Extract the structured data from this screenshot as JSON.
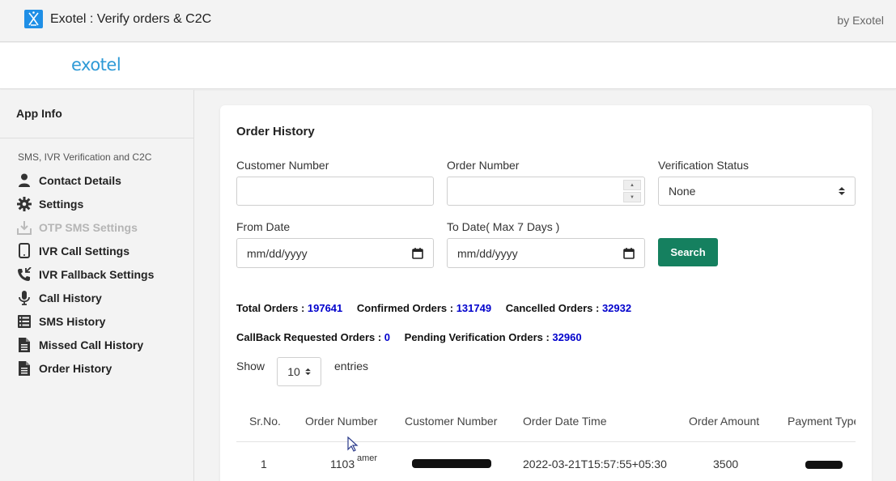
{
  "titlebar": {
    "title": "Exotel : Verify orders & C2C",
    "by": "by Exotel"
  },
  "header": {
    "logo_text": "exotel"
  },
  "sidebar": {
    "app_info": "App Info",
    "section_label": "SMS, IVR Verification and C2C",
    "items": [
      {
        "label": "Contact Details",
        "icon": "user-icon"
      },
      {
        "label": "Settings",
        "icon": "gear-icon"
      },
      {
        "label": "OTP SMS Settings",
        "icon": "download-icon"
      },
      {
        "label": "IVR Call Settings",
        "icon": "mobile-phone-icon"
      },
      {
        "label": "IVR Fallback Settings",
        "icon": "phone-callback-icon"
      },
      {
        "label": "Call History",
        "icon": "microphone-icon"
      },
      {
        "label": "SMS History",
        "icon": "list-icon"
      },
      {
        "label": "Missed Call History",
        "icon": "document-icon"
      },
      {
        "label": "Order History",
        "icon": "document-icon"
      }
    ]
  },
  "main": {
    "title": "Order History",
    "filters": {
      "customer_number_label": "Customer Number",
      "customer_number_value": "",
      "order_number_label": "Order Number",
      "order_number_value": "",
      "verification_status_label": "Verification Status",
      "verification_status_value": "None",
      "from_date_label": "From Date",
      "from_date_placeholder": "mm/dd/yyyy",
      "to_date_label": "To Date( Max 7 Days )",
      "to_date_placeholder": "mm/dd/yyyy",
      "search_label": "Search"
    },
    "stats": {
      "total_label": "Total Orders : ",
      "total_value": "197641",
      "confirmed_label": "Confirmed Orders : ",
      "confirmed_value": "131749",
      "cancelled_label": "Cancelled Orders : ",
      "cancelled_value": "32932",
      "callback_label": "CallBack Requested Orders : ",
      "callback_value": "0",
      "pending_label": "Pending Verification Orders : ",
      "pending_value": "32960"
    },
    "entries": {
      "show_label": "Show",
      "value": "10",
      "entries_label": "entries"
    },
    "table": {
      "headers": [
        "Sr.No.",
        "Order Number",
        "Customer Number",
        "Order Date Time",
        "Order Amount",
        "Payment Type"
      ],
      "rows": [
        {
          "sr": "1",
          "order_number": "1103",
          "order_suffix": "amer",
          "order_date_time": "2022-03-21T15:57:55+05:30",
          "amount": "3500"
        }
      ]
    }
  },
  "colors": {
    "brand": "#2e9ad6",
    "search_button": "#15805f",
    "stat_value": "#0000cc"
  }
}
